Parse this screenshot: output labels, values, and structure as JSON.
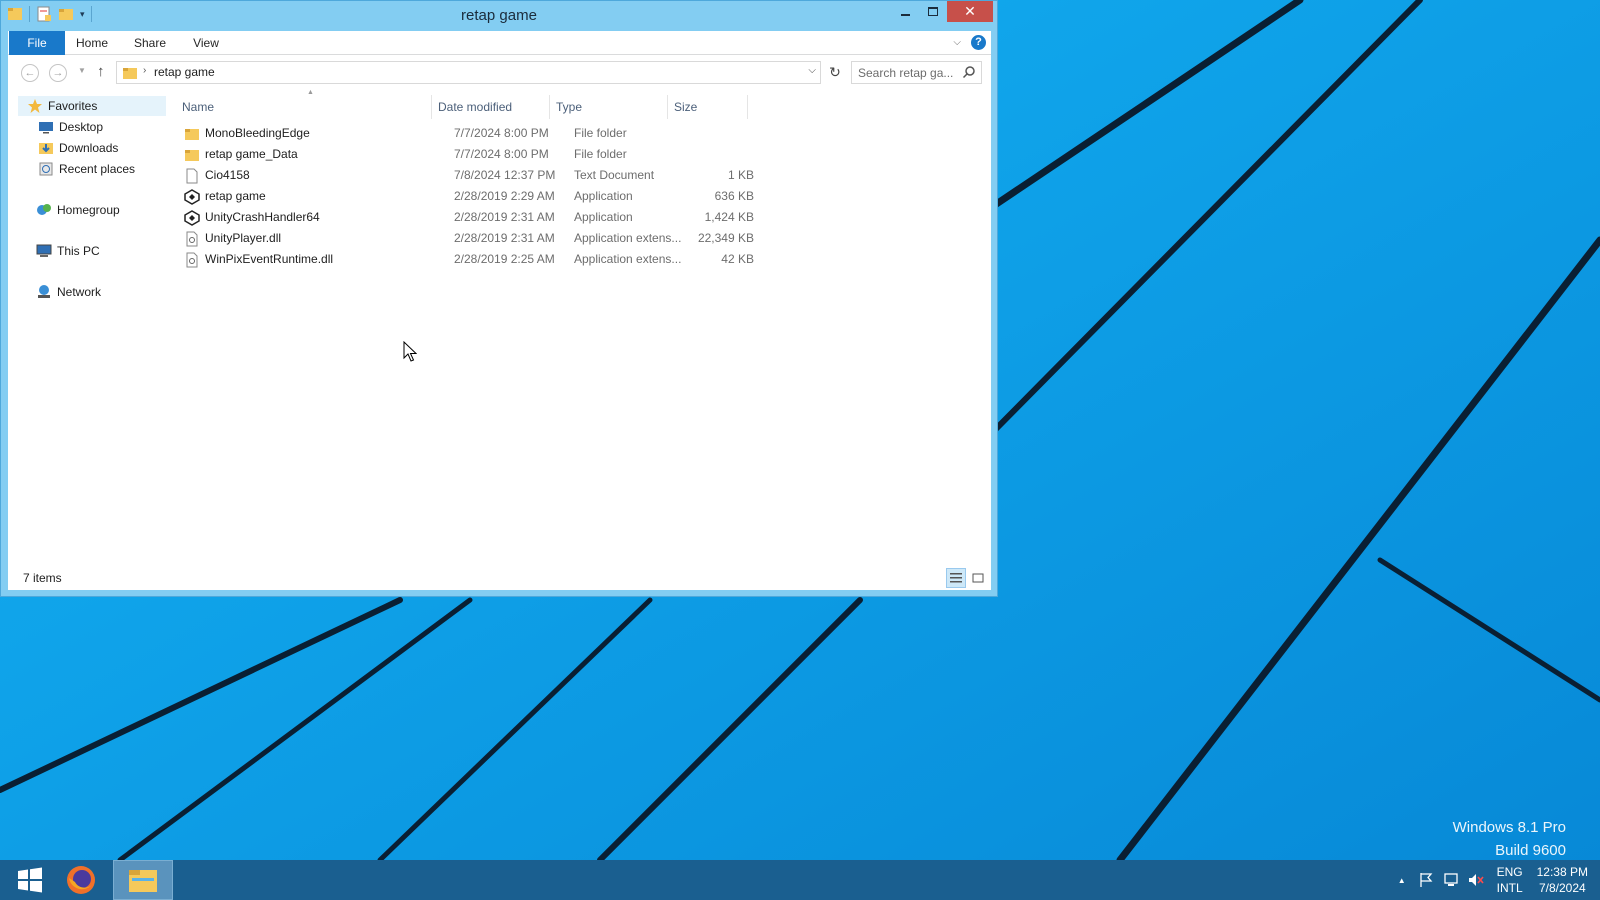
{
  "window": {
    "title": "retap game",
    "controls": {
      "minimize_icon": "minimize-icon",
      "maximize_icon": "maximize-icon",
      "close_label": "✕"
    }
  },
  "ribbon": {
    "tabs": [
      {
        "label": "File"
      },
      {
        "label": "Home"
      },
      {
        "label": "Share"
      },
      {
        "label": "View"
      }
    ],
    "help_label": "?"
  },
  "address": {
    "crumb": "retap game",
    "search_placeholder": "Search retap ga..."
  },
  "nav_pane": {
    "favorites": "Favorites",
    "desktop": "Desktop",
    "downloads": "Downloads",
    "recent": "Recent places",
    "homegroup": "Homegroup",
    "this_pc": "This PC",
    "network": "Network"
  },
  "file_list": {
    "columns": [
      {
        "label": "Name"
      },
      {
        "label": "Date modified"
      },
      {
        "label": "Type"
      },
      {
        "label": "Size"
      }
    ],
    "rows": [
      {
        "name": "MonoBleedingEdge",
        "date": "7/7/2024 8:00 PM",
        "type": "File folder",
        "size": "",
        "icon": "folder-icon"
      },
      {
        "name": "retap game_Data",
        "date": "7/7/2024 8:00 PM",
        "type": "File folder",
        "size": "",
        "icon": "folder-icon"
      },
      {
        "name": "Cio4158",
        "date": "7/8/2024 12:37 PM",
        "type": "Text Document",
        "size": "1 KB",
        "icon": "text-file-icon"
      },
      {
        "name": "retap game",
        "date": "2/28/2019 2:29 AM",
        "type": "Application",
        "size": "636 KB",
        "icon": "unity-app-icon"
      },
      {
        "name": "UnityCrashHandler64",
        "date": "2/28/2019 2:31 AM",
        "type": "Application",
        "size": "1,424 KB",
        "icon": "unity-app-icon"
      },
      {
        "name": "UnityPlayer.dll",
        "date": "2/28/2019 2:31 AM",
        "type": "Application extens...",
        "size": "22,349 KB",
        "icon": "dll-file-icon"
      },
      {
        "name": "WinPixEventRuntime.dll",
        "date": "2/28/2019 2:25 AM",
        "type": "Application extens...",
        "size": "42 KB",
        "icon": "dll-file-icon"
      }
    ]
  },
  "status": {
    "item_count": "7 items"
  },
  "watermark": {
    "line1": "Windows 8.1 Pro",
    "line2": "Build 9600"
  },
  "taskbar": {
    "lang_line1": "ENG",
    "lang_line2": "INTL",
    "time": "12:38 PM",
    "date": "7/8/2024"
  },
  "colors": {
    "desktop_bg": "#0b9ae6",
    "window_frame": "#83cdf2",
    "close_button": "#c7504a",
    "file_tab": "#1979ca",
    "taskbar": "#1a5f90"
  }
}
